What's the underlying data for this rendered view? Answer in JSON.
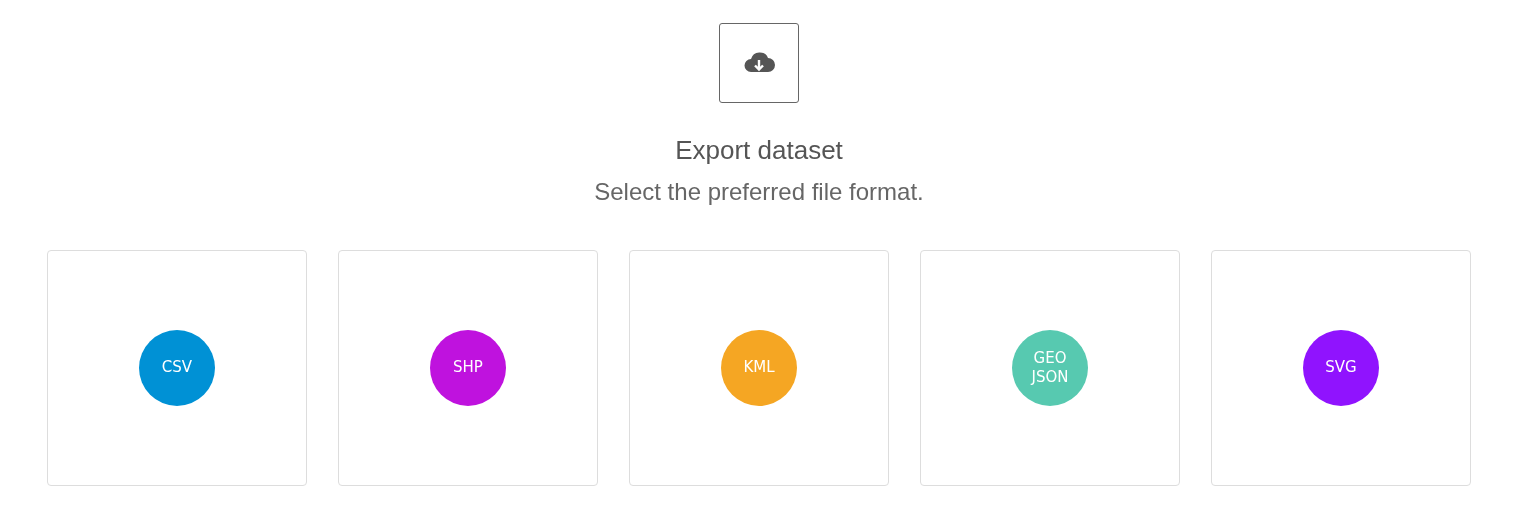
{
  "dialog": {
    "title": "Export dataset",
    "subtitle": "Select the preferred file format.",
    "formats": [
      {
        "label": "CSV",
        "color": "#0091d5"
      },
      {
        "label": "SHP",
        "color": "#bf12de"
      },
      {
        "label": "KML",
        "color": "#f5a623"
      },
      {
        "label": "GEO JSON",
        "color": "#57c9b0"
      },
      {
        "label": "SVG",
        "color": "#9013fe"
      }
    ]
  }
}
